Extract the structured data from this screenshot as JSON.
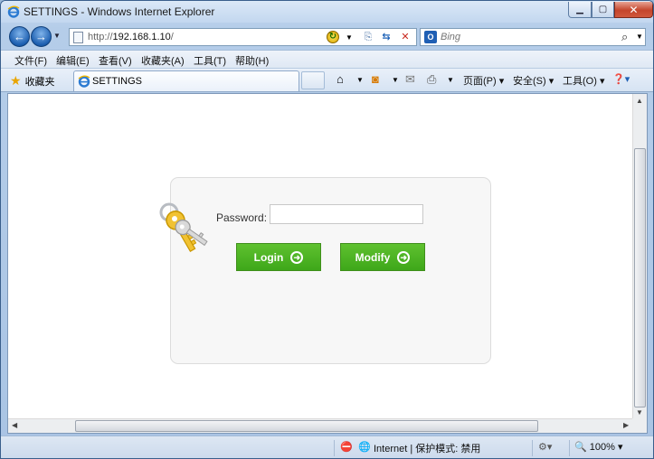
{
  "window": {
    "title": "SETTINGS - Windows Internet Explorer",
    "min_icon": "minimize-icon",
    "max_icon": "maximize-icon",
    "close_icon": "close-icon"
  },
  "address": {
    "url_prefix": "http://",
    "url_host": "192.168.1.10",
    "url_suffix": "/"
  },
  "search": {
    "placeholder": "Bing",
    "provider_icon": "bing-icon"
  },
  "menu": {
    "items": [
      {
        "label": "文件(F)"
      },
      {
        "label": "编辑(E)"
      },
      {
        "label": "查看(V)"
      },
      {
        "label": "收藏夹(A)"
      },
      {
        "label": "工具(T)"
      },
      {
        "label": "帮助(H)"
      }
    ]
  },
  "tabbar": {
    "favorites_label": "收藏夹",
    "tab_label": "SETTINGS",
    "commands": {
      "page": "页面(P)",
      "safety": "安全(S)",
      "tools": "工具(O)"
    }
  },
  "login": {
    "password_label": "Password:",
    "password_value": "",
    "login_label": "Login",
    "modify_label": "Modify",
    "accent_color": "#4cb322"
  },
  "status": {
    "zone": "Internet | 保护模式: 禁用",
    "zoom": "100%"
  }
}
